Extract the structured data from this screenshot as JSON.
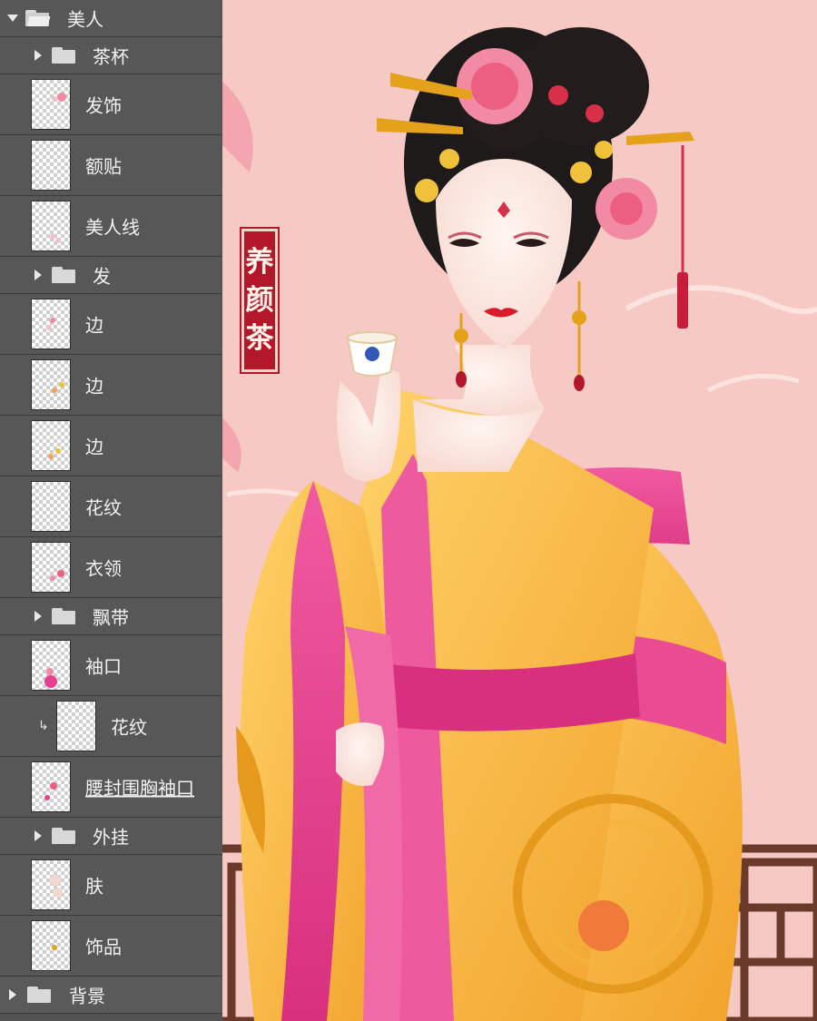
{
  "layers_panel": {
    "top_group": {
      "label": "美人",
      "icon": "folder-open-icon",
      "state": "expanded"
    },
    "rows": [
      {
        "kind": "group",
        "label": "茶杯"
      },
      {
        "kind": "layer",
        "label": "发饰"
      },
      {
        "kind": "layer",
        "label": "额贴"
      },
      {
        "kind": "layer",
        "label": "美人线"
      },
      {
        "kind": "group",
        "label": "发"
      },
      {
        "kind": "layer",
        "label": "边"
      },
      {
        "kind": "layer",
        "label": "边"
      },
      {
        "kind": "layer",
        "label": "边"
      },
      {
        "kind": "layer",
        "label": "花纹"
      },
      {
        "kind": "layer",
        "label": "衣领"
      },
      {
        "kind": "group",
        "label": "飘带"
      },
      {
        "kind": "layer",
        "label": "袖口"
      },
      {
        "kind": "clipped_layer",
        "label": "花纹"
      },
      {
        "kind": "layer",
        "label": "腰封围胸袖口"
      },
      {
        "kind": "group",
        "label": "外挂"
      },
      {
        "kind": "layer",
        "label": "肤"
      },
      {
        "kind": "layer",
        "label": "饰品"
      }
    ],
    "bottom_group": {
      "label": "背景",
      "icon": "folder-icon",
      "state": "collapsed"
    }
  },
  "artwork": {
    "seal_text": [
      "养",
      "颜",
      "茶"
    ],
    "colors": {
      "background": "#f6c9c5",
      "robe_yellow": "#f5b335",
      "robe_pink": "#e9408f",
      "hair": "#1f1a1a",
      "seal_red": "#b3182a",
      "lattice_brown": "#6b3a2a"
    }
  }
}
